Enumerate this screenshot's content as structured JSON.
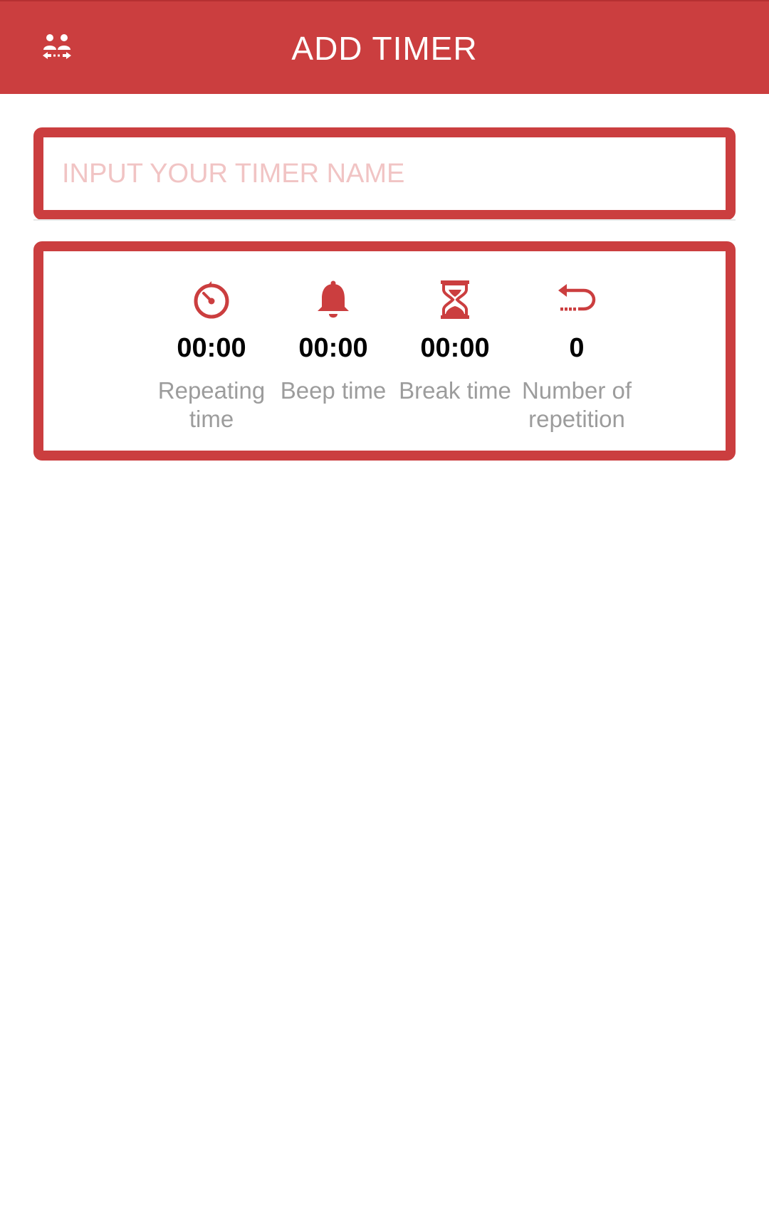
{
  "app_bar": {
    "title": "ADD TIMER",
    "menu_icon": "two-people-swap-icon",
    "background_color": "#cb3e3f"
  },
  "timer_name": {
    "value": "",
    "placeholder": "INPUT YOUR TIMER NAME"
  },
  "settings": {
    "accent_color": "#cb3e3f",
    "items": [
      {
        "icon": "stopwatch-icon",
        "value": "00:00",
        "label": "Repeating time"
      },
      {
        "icon": "bell-icon",
        "value": "00:00",
        "label": "Beep time"
      },
      {
        "icon": "hourglass-icon",
        "value": "00:00",
        "label": "Break time"
      },
      {
        "icon": "repeat-arrow-icon",
        "value": "0",
        "label": "Number of repetition"
      }
    ]
  }
}
